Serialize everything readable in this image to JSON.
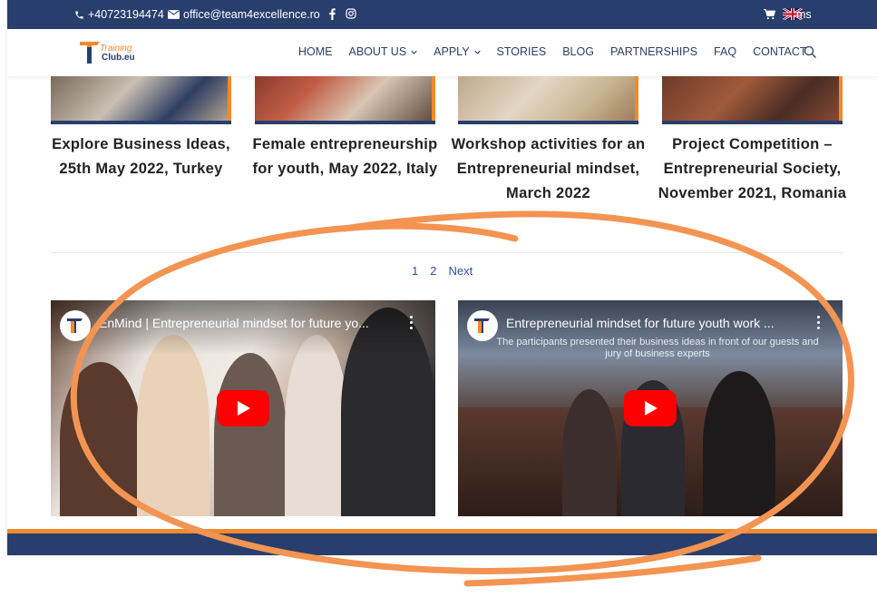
{
  "topbar": {
    "phone": "+40723194474",
    "email": "office@team4excellence.ro",
    "language_suffix": "ms"
  },
  "logo": {
    "line1": "Training",
    "line2": "Club.eu"
  },
  "nav": {
    "items": [
      {
        "label": "HOME",
        "dropdown": false
      },
      {
        "label": "ABOUT US",
        "dropdown": true
      },
      {
        "label": "APPLY",
        "dropdown": true
      },
      {
        "label": "STORIES",
        "dropdown": false
      },
      {
        "label": "BLOG",
        "dropdown": false
      },
      {
        "label": "PARTNERSHIPS",
        "dropdown": false
      },
      {
        "label": "FAQ",
        "dropdown": false
      },
      {
        "label": "CONTACT",
        "dropdown": false
      }
    ]
  },
  "posts": [
    {
      "title": "Explore Business Ideas, 25th May 2022, Turkey"
    },
    {
      "title": "Female entrepreneurship for youth, May 2022, Italy"
    },
    {
      "title": "Workshop activities for an Entrepreneurial mindset, March 2022"
    },
    {
      "title": "Project Competition – Entrepreneurial Society, November 2021, Romania"
    }
  ],
  "pagination": {
    "page1": "1",
    "page2": "2",
    "next": "Next"
  },
  "videos": [
    {
      "title": "EnMind | Entrepreneurial mindset for future yo...",
      "subtitle": ""
    },
    {
      "title": "Entrepreneurial mindset for future youth work ...",
      "subtitle": "The participants presented their business ideas in front of our guests and jury of business experts"
    }
  ],
  "colors": {
    "brand_blue": "#283e6c",
    "brand_orange": "#f08a2c",
    "annotation": "#f39452",
    "youtube_red": "#ff0000"
  }
}
